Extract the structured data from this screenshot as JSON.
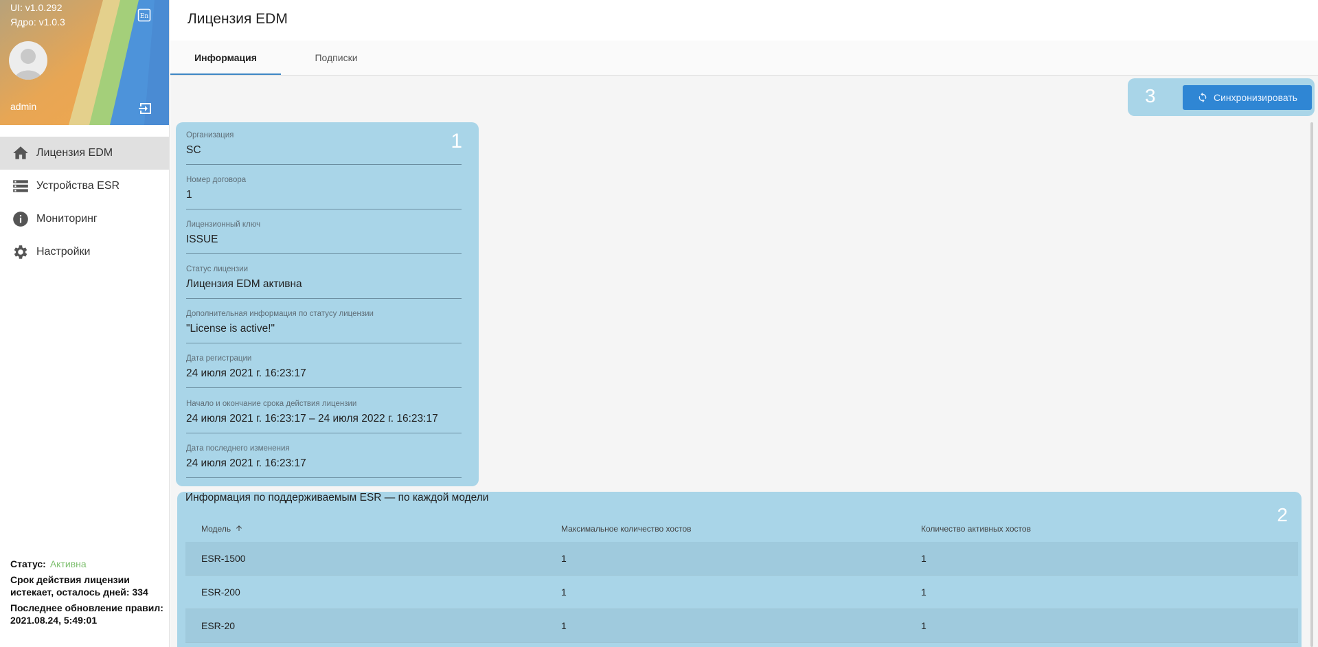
{
  "sidebar": {
    "ui_version": "UI: v1.0.292",
    "core_version": "Ядро: v1.0.3",
    "username": "admin",
    "items": [
      {
        "label": "Лицензия EDM",
        "icon": "home-icon",
        "active": true
      },
      {
        "label": "Устройства ESR",
        "icon": "storage-icon",
        "active": false
      },
      {
        "label": "Мониторинг",
        "icon": "info-icon",
        "active": false
      },
      {
        "label": "Настройки",
        "icon": "gear-icon",
        "active": false
      }
    ],
    "footer": {
      "status_label": "Статус:",
      "status_value": "Активна",
      "expiry_text": "Срок действия лицензии истекает, осталось дней: 334",
      "update_text": "Последнее обновление правил: 2021.08.24, 5:49:01"
    }
  },
  "header": {
    "title": "Лицензия EDM"
  },
  "tabs": [
    {
      "label": "Информация",
      "active": true
    },
    {
      "label": "Подписки",
      "active": false
    }
  ],
  "sync": {
    "marker": "3",
    "button_label": "Синхронизировать"
  },
  "info": {
    "marker": "1",
    "fields": [
      {
        "label": "Организация",
        "value": "SC"
      },
      {
        "label": "Номер договора",
        "value": "1"
      },
      {
        "label": "Лицензионный ключ",
        "value": "ISSUE"
      },
      {
        "label": "Статус лицензии",
        "value": "Лицензия EDM активна"
      },
      {
        "label": "Дополнительная информация по статусу лицензии",
        "value": "\"License is active!\""
      },
      {
        "label": "Дата регистрации",
        "value": "24 июля 2021 г. 16:23:17"
      },
      {
        "label": "Начало и окончание срока действия лицензии",
        "value": "24 июля 2021 г. 16:23:17 – 24 июля 2022 г. 16:23:17"
      },
      {
        "label": "Дата последнего изменения",
        "value": "24 июля 2021 г. 16:23:17"
      }
    ]
  },
  "esr_table": {
    "marker": "2",
    "title": "Информация по поддерживаемым ESR — по каждой модели",
    "columns": [
      "Модель",
      "Максимальное количество хостов",
      "Количество активных хостов"
    ],
    "rows": [
      [
        "ESR-1500",
        "1",
        "1"
      ],
      [
        "ESR-200",
        "1",
        "1"
      ],
      [
        "ESR-20",
        "1",
        "1"
      ]
    ]
  },
  "colors": {
    "accent": "#2f86d4",
    "highlight": "#a9d5e8",
    "status_active": "#7dbf6e"
  }
}
